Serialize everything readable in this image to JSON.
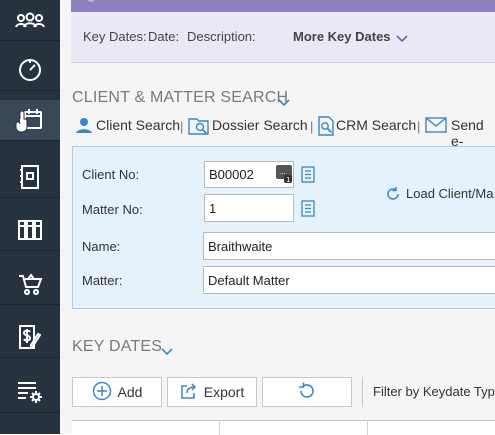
{
  "sidebar": {
    "items": [
      {
        "icon": "people-group-icon",
        "name": "sidebar-item-team"
      },
      {
        "icon": "dashboard-gauge-icon",
        "name": "sidebar-item-dashboard"
      },
      {
        "icon": "calendar-hand-icon",
        "name": "sidebar-item-keydates"
      },
      {
        "icon": "document-icon",
        "name": "sidebar-item-documents"
      },
      {
        "icon": "library-books-icon",
        "name": "sidebar-item-library"
      },
      {
        "icon": "shopping-cart-icon",
        "name": "sidebar-item-cart"
      },
      {
        "icon": "billing-pen-icon",
        "name": "sidebar-item-billing"
      },
      {
        "icon": "settings-list-icon",
        "name": "sidebar-item-settings"
      }
    ],
    "active_index": 2,
    "colors": {
      "bg": "#27323f",
      "active": "#3a4756"
    }
  },
  "key_dates_bar": {
    "label_key_dates": "Key Dates:",
    "label_date": "Date:",
    "label_description": "Description:",
    "more_label": "More Key Dates"
  },
  "client_search": {
    "title": "CLIENT & MATTER SEARCH",
    "links": {
      "client": "Client Search",
      "dossier": "Dossier Search",
      "crm": "CRM Search",
      "send": "Send e-"
    },
    "separator": "|",
    "fields": {
      "client_no_label": "Client No:",
      "client_no_value": "B00002",
      "matter_no_label": "Matter No:",
      "matter_no_value": "1",
      "name_label": "Name:",
      "name_value": "Braithwaite",
      "matter_label": "Matter:",
      "matter_value": "Default Matter"
    },
    "load_label": "Load Client/Ma"
  },
  "key_dates": {
    "title": "KEY DATES",
    "add_label": "Add",
    "export_label": "Export",
    "filter_label": "Filter by Keydate Typ"
  },
  "colors": {
    "accent": "#3a87c7",
    "panel_bg": "#e6f2fb",
    "purple": "#8e7fc0"
  }
}
